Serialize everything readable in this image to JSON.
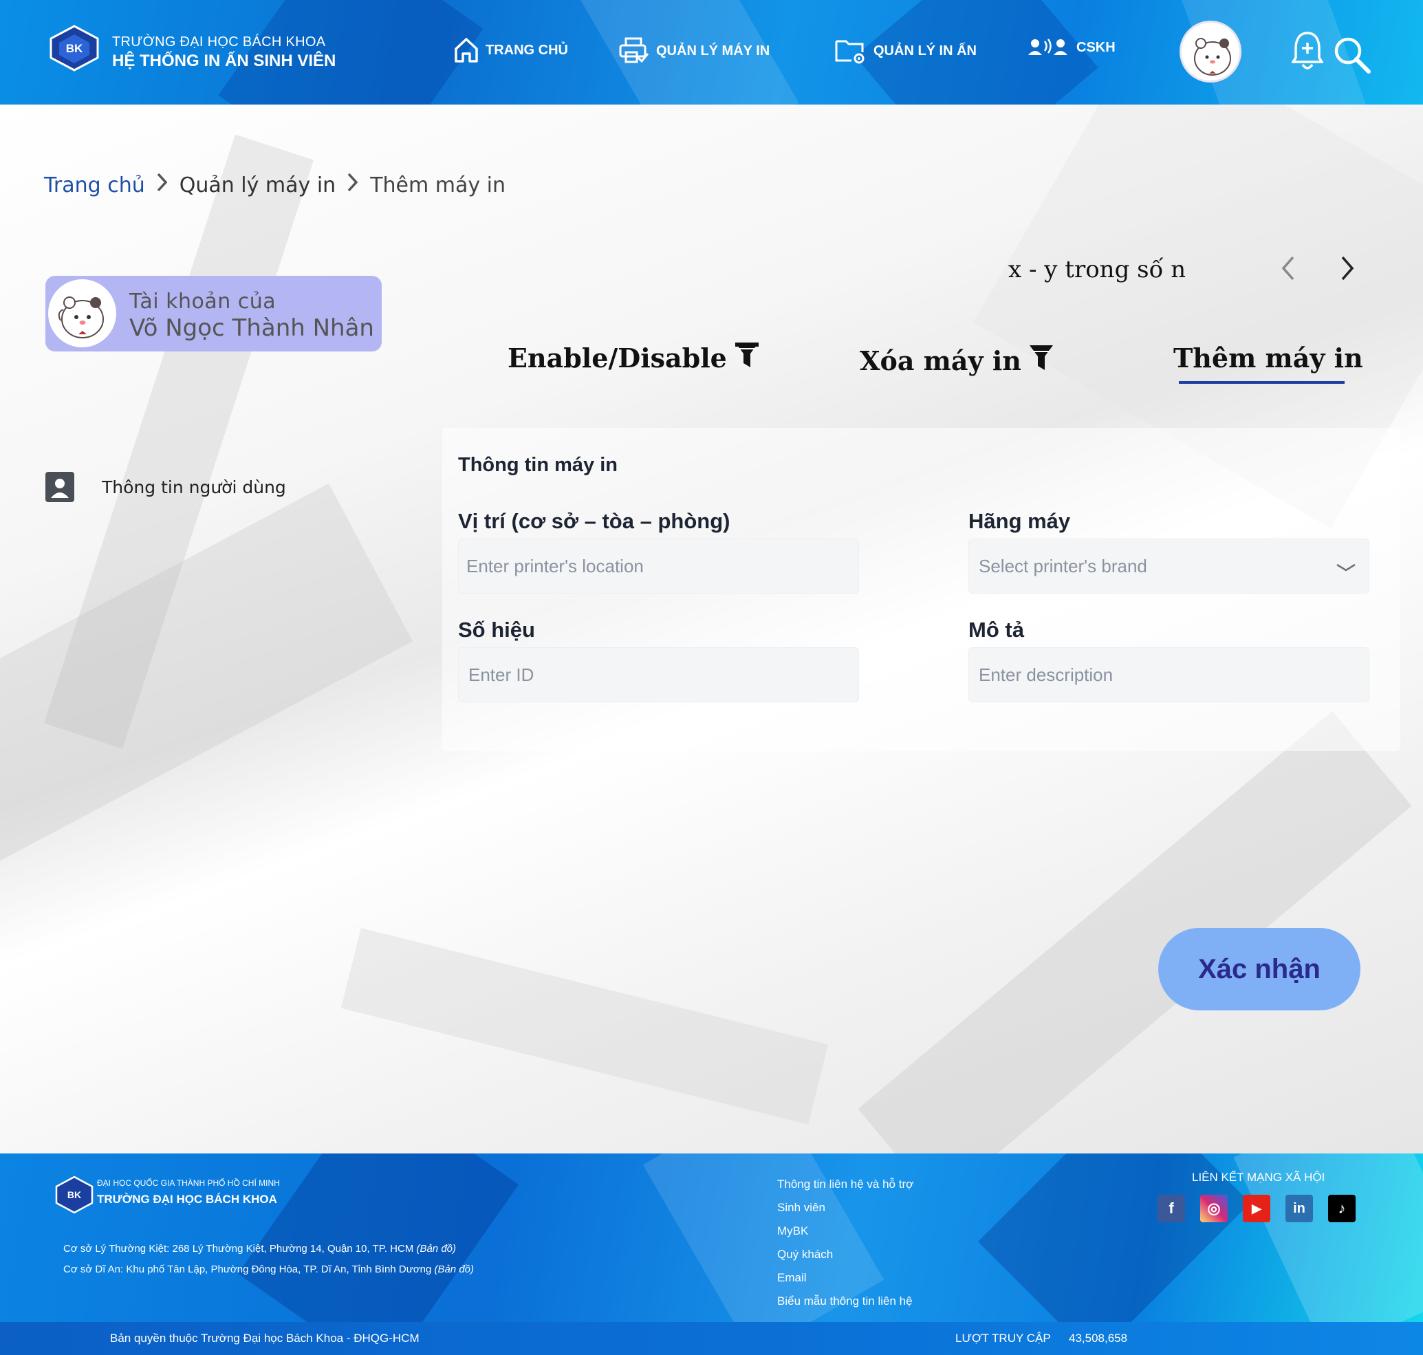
{
  "header": {
    "brand_line1": "TRƯỜNG ĐẠI HỌC BÁCH KHOA",
    "brand_line2": "HỆ THỐNG IN ẤN SINH VIÊN",
    "logo_text": "BK",
    "nav": [
      {
        "label": "TRANG CHỦ",
        "icon": "home-icon"
      },
      {
        "label": "QUẢN LÝ MÁY IN",
        "icon": "printer-check-icon"
      },
      {
        "label": "QUẢN LÝ IN ẤN",
        "icon": "folder-gear-icon"
      },
      {
        "label": "CSKH",
        "icon": "support-users-icon"
      }
    ]
  },
  "breadcrumb": {
    "home": "Trang chủ",
    "level2": "Quản lý máy in",
    "current": "Thêm máy in"
  },
  "account": {
    "label": "Tài khoản của",
    "name": "Võ Ngọc Thành Nhân"
  },
  "sidebar": {
    "items": [
      {
        "label": "Thông tin người dùng",
        "icon": "user-card-icon"
      }
    ]
  },
  "pager": {
    "text": "x - y trong số n"
  },
  "tabs": [
    {
      "label": "Enable/Disable",
      "icon": "filter-icon"
    },
    {
      "label": "Xóa máy in",
      "icon": "filter-icon"
    },
    {
      "label": "Thêm máy in",
      "active": true
    }
  ],
  "form": {
    "title": "Thông tin máy in",
    "location": {
      "label": "Vị trí (cơ sở – tòa – phòng)",
      "placeholder": "Enter printer's location"
    },
    "brand": {
      "label": "Hãng máy",
      "placeholder": "Select printer's brand"
    },
    "id": {
      "label": "Số hiệu",
      "placeholder": "Enter ID"
    },
    "description": {
      "label": "Mô tả",
      "placeholder": "Enter description"
    },
    "confirm": "Xác nhận"
  },
  "footer": {
    "uni_line1": "ĐẠI HỌC QUỐC GIA THÀNH PHỐ HỒ CHÍ MINH",
    "uni_line2": "TRƯỜNG ĐẠI HỌC BÁCH KHOA",
    "addr1": "Cơ sở Lý Thường Kiệt: 268 Lý Thường Kiệt, Phường 14, Quận 10, TP. HCM",
    "addr1_map": "(Bản đồ)",
    "addr2": "Cơ sở Dĩ An: Khu phố Tân Lập, Phường Đông Hòa, TP. Dĩ An, Tỉnh Bình Dương",
    "addr2_map": "(Bản đồ)",
    "links": [
      "Thông tin liên hệ và hỗ trợ",
      "Sinh viên",
      "MyBK",
      "Quý khách",
      "Email",
      "Biểu mẫu thông tin liên hệ"
    ],
    "social_title": "LIÊN KẾT MẠNG XÃ HỘI",
    "social": [
      {
        "name": "facebook-icon",
        "glyph": "f",
        "color": "#3b5998"
      },
      {
        "name": "instagram-icon",
        "glyph": "◎",
        "color": "#d62976"
      },
      {
        "name": "youtube-icon",
        "glyph": "▶",
        "color": "#e62117"
      },
      {
        "name": "linkedin-icon",
        "glyph": "in",
        "color": "#2a6fb0"
      },
      {
        "name": "tiktok-icon",
        "glyph": "♪",
        "color": "#000000"
      }
    ],
    "copyright": "Bản quyền thuộc Trường Đại học Bách Khoa - ĐHQG-HCM",
    "visits_label": "LƯỢT TRUY CẬP",
    "visits_value": "43,508,658"
  },
  "colors": {
    "header_blue": "#0b6fd0",
    "account_card": "#b3b6f2",
    "tab_underline": "#1f3ea3",
    "confirm_button": "#7fb0f5"
  }
}
